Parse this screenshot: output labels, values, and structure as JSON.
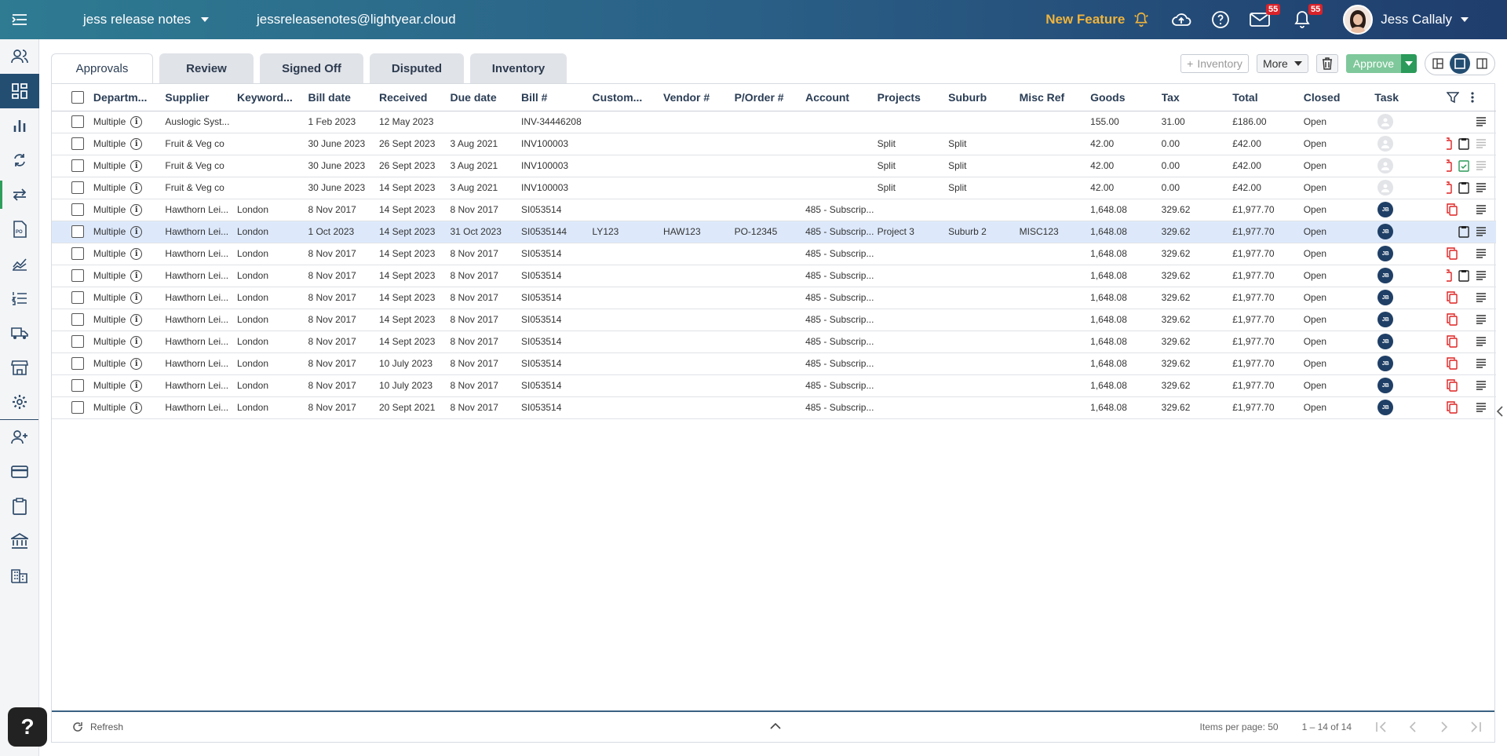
{
  "topbar": {
    "org_name": "jess release notes",
    "email": "jessreleasenotes@lightyear.cloud",
    "new_feature": "New Feature",
    "mail_badge": "55",
    "notif_badge": "55",
    "user_name": "Jess Callaly"
  },
  "tabs": [
    {
      "label": "Approvals"
    },
    {
      "label": "Review"
    },
    {
      "label": "Signed Off"
    },
    {
      "label": "Disputed"
    },
    {
      "label": "Inventory"
    }
  ],
  "toolbar": {
    "inventory_label": "Inventory",
    "more_label": "More",
    "approve_label": "Approve"
  },
  "columns": [
    "Departm...",
    "Supplier",
    "Keyword...",
    "Bill date",
    "Received",
    "Due date",
    "Bill #",
    "Custom...",
    "Vendor #",
    "P/Order #",
    "Account",
    "Projects",
    "Suburb",
    "Misc Ref",
    "Goods",
    "Tax",
    "Total",
    "Closed",
    "Task"
  ],
  "rows": [
    {
      "dept": "Multiple",
      "supplier": "Auslogic Syst...",
      "keyword": "",
      "bill_date": "1 Feb 2023",
      "received": "12 May 2023",
      "due": "",
      "bill": "INV-34446208",
      "custom": "",
      "vendor": "",
      "po": "",
      "account": "",
      "projects": "",
      "suburb": "",
      "misc": "",
      "goods": "155.00",
      "tax": "31.00",
      "total": "£186.00",
      "closed": "Open",
      "task": ""
    },
    {
      "dept": "Multiple",
      "supplier": "Fruit & Veg co",
      "keyword": "",
      "bill_date": "30 June 2023",
      "received": "26 Sept 2023",
      "due": "3 Aug 2021",
      "bill": "INV100003",
      "custom": "",
      "vendor": "",
      "po": "",
      "account": "",
      "projects": "Split",
      "suburb": "Split",
      "misc": "",
      "goods": "42.00",
      "tax": "0.00",
      "total": "£42.00",
      "closed": "Open",
      "task": ""
    },
    {
      "dept": "Multiple",
      "supplier": "Fruit & Veg co",
      "keyword": "",
      "bill_date": "30 June 2023",
      "received": "26 Sept 2023",
      "due": "3 Aug 2021",
      "bill": "INV100003",
      "custom": "",
      "vendor": "",
      "po": "",
      "account": "",
      "projects": "Split",
      "suburb": "Split",
      "misc": "",
      "goods": "42.00",
      "tax": "0.00",
      "total": "£42.00",
      "closed": "Open",
      "task": ""
    },
    {
      "dept": "Multiple",
      "supplier": "Fruit & Veg co",
      "keyword": "",
      "bill_date": "30 June 2023",
      "received": "14 Sept 2023",
      "due": "3 Aug 2021",
      "bill": "INV100003",
      "custom": "",
      "vendor": "",
      "po": "",
      "account": "",
      "projects": "Split",
      "suburb": "Split",
      "misc": "",
      "goods": "42.00",
      "tax": "0.00",
      "total": "£42.00",
      "closed": "Open",
      "task": ""
    },
    {
      "dept": "Multiple",
      "supplier": "Hawthorn Lei...",
      "keyword": "London",
      "bill_date": "8 Nov 2017",
      "received": "14 Sept 2023",
      "due": "8 Nov 2017",
      "bill": "SI053514",
      "custom": "",
      "vendor": "",
      "po": "",
      "account": "485 - Subscrip...",
      "projects": "",
      "suburb": "",
      "misc": "",
      "goods": "1,648.08",
      "tax": "329.62",
      "total": "£1,977.70",
      "closed": "Open",
      "task": "JB"
    },
    {
      "dept": "Multiple",
      "supplier": "Hawthorn Lei...",
      "keyword": "London",
      "bill_date": "1 Oct 2023",
      "received": "14 Sept 2023",
      "due": "31 Oct 2023",
      "bill": "SI0535144",
      "custom": "LY123",
      "vendor": "HAW123",
      "po": "PO-12345",
      "account": "485 - Subscrip...",
      "projects": "Project 3",
      "suburb": "Suburb 2",
      "misc": "MISC123",
      "goods": "1,648.08",
      "tax": "329.62",
      "total": "£1,977.70",
      "closed": "Open",
      "task": "JB"
    },
    {
      "dept": "Multiple",
      "supplier": "Hawthorn Lei...",
      "keyword": "London",
      "bill_date": "8 Nov 2017",
      "received": "14 Sept 2023",
      "due": "8 Nov 2017",
      "bill": "SI053514",
      "custom": "",
      "vendor": "",
      "po": "",
      "account": "485 - Subscrip...",
      "projects": "",
      "suburb": "",
      "misc": "",
      "goods": "1,648.08",
      "tax": "329.62",
      "total": "£1,977.70",
      "closed": "Open",
      "task": "JB"
    },
    {
      "dept": "Multiple",
      "supplier": "Hawthorn Lei...",
      "keyword": "London",
      "bill_date": "8 Nov 2017",
      "received": "14 Sept 2023",
      "due": "8 Nov 2017",
      "bill": "SI053514",
      "custom": "",
      "vendor": "",
      "po": "",
      "account": "485 - Subscrip...",
      "projects": "",
      "suburb": "",
      "misc": "",
      "goods": "1,648.08",
      "tax": "329.62",
      "total": "£1,977.70",
      "closed": "Open",
      "task": "JB"
    },
    {
      "dept": "Multiple",
      "supplier": "Hawthorn Lei...",
      "keyword": "London",
      "bill_date": "8 Nov 2017",
      "received": "14 Sept 2023",
      "due": "8 Nov 2017",
      "bill": "SI053514",
      "custom": "",
      "vendor": "",
      "po": "",
      "account": "485 - Subscrip...",
      "projects": "",
      "suburb": "",
      "misc": "",
      "goods": "1,648.08",
      "tax": "329.62",
      "total": "£1,977.70",
      "closed": "Open",
      "task": "JB"
    },
    {
      "dept": "Multiple",
      "supplier": "Hawthorn Lei...",
      "keyword": "London",
      "bill_date": "8 Nov 2017",
      "received": "14 Sept 2023",
      "due": "8 Nov 2017",
      "bill": "SI053514",
      "custom": "",
      "vendor": "",
      "po": "",
      "account": "485 - Subscrip...",
      "projects": "",
      "suburb": "",
      "misc": "",
      "goods": "1,648.08",
      "tax": "329.62",
      "total": "£1,977.70",
      "closed": "Open",
      "task": "JB"
    },
    {
      "dept": "Multiple",
      "supplier": "Hawthorn Lei...",
      "keyword": "London",
      "bill_date": "8 Nov 2017",
      "received": "14 Sept 2023",
      "due": "8 Nov 2017",
      "bill": "SI053514",
      "custom": "",
      "vendor": "",
      "po": "",
      "account": "485 - Subscrip...",
      "projects": "",
      "suburb": "",
      "misc": "",
      "goods": "1,648.08",
      "tax": "329.62",
      "total": "£1,977.70",
      "closed": "Open",
      "task": "JB"
    },
    {
      "dept": "Multiple",
      "supplier": "Hawthorn Lei...",
      "keyword": "London",
      "bill_date": "8 Nov 2017",
      "received": "10 July 2023",
      "due": "8 Nov 2017",
      "bill": "SI053514",
      "custom": "",
      "vendor": "",
      "po": "",
      "account": "485 - Subscrip...",
      "projects": "",
      "suburb": "",
      "misc": "",
      "goods": "1,648.08",
      "tax": "329.62",
      "total": "£1,977.70",
      "closed": "Open",
      "task": "JB"
    },
    {
      "dept": "Multiple",
      "supplier": "Hawthorn Lei...",
      "keyword": "London",
      "bill_date": "8 Nov 2017",
      "received": "10 July 2023",
      "due": "8 Nov 2017",
      "bill": "SI053514",
      "custom": "",
      "vendor": "",
      "po": "",
      "account": "485 - Subscrip...",
      "projects": "",
      "suburb": "",
      "misc": "",
      "goods": "1,648.08",
      "tax": "329.62",
      "total": "£1,977.70",
      "closed": "Open",
      "task": "JB"
    },
    {
      "dept": "Multiple",
      "supplier": "Hawthorn Lei...",
      "keyword": "London",
      "bill_date": "8 Nov 2017",
      "received": "20 Sept 2021",
      "due": "8 Nov 2017",
      "bill": "SI053514",
      "custom": "",
      "vendor": "",
      "po": "",
      "account": "485 - Subscrip...",
      "projects": "",
      "suburb": "",
      "misc": "",
      "goods": "1,648.08",
      "tax": "329.62",
      "total": "£1,977.70",
      "closed": "Open",
      "task": "JB"
    }
  ],
  "footer": {
    "refresh_label": "Refresh",
    "items_per_page": "Items per page: 50",
    "range": "1 – 14 of 14"
  },
  "colors": {
    "brand_dark": "#244d72",
    "accent_green": "#2b9a5a",
    "new_feature": "#f0b43c",
    "badge_red": "#d9222a"
  }
}
